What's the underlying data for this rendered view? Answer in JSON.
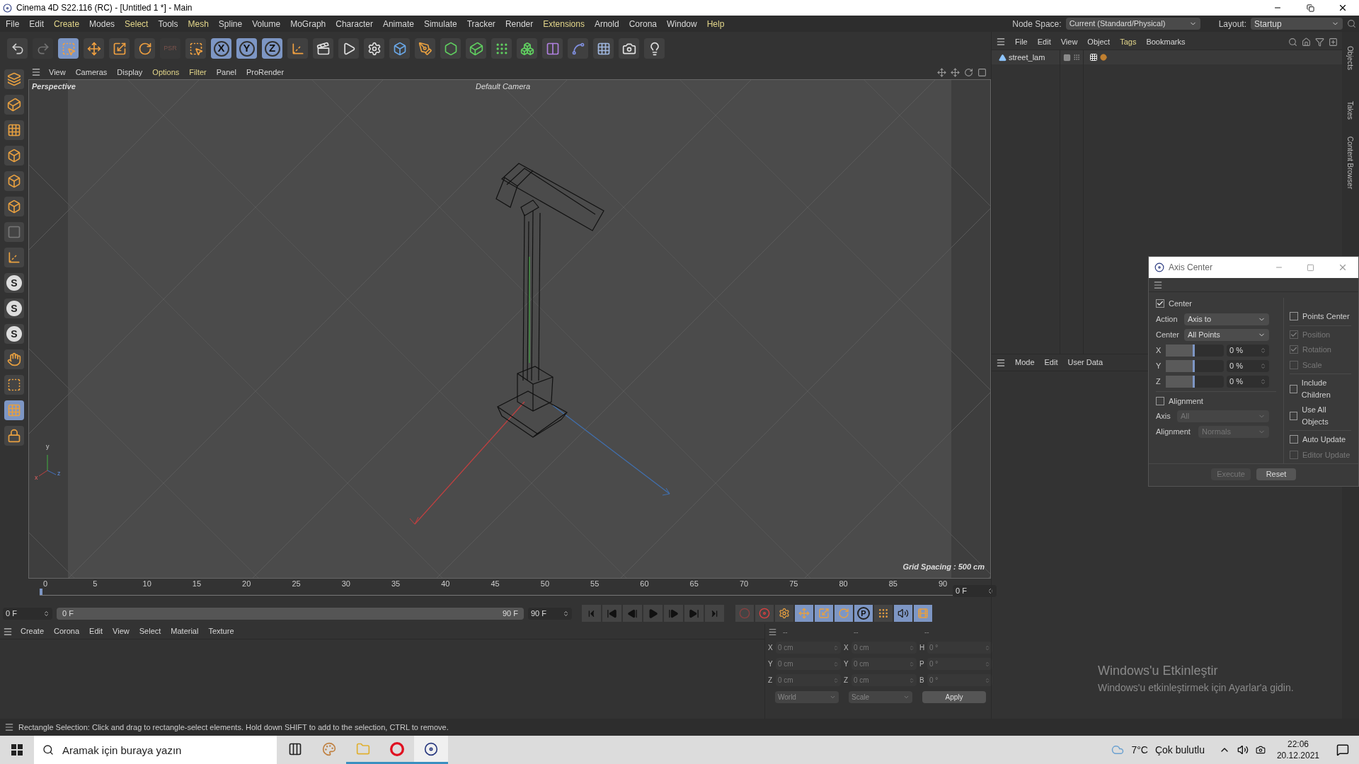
{
  "window": {
    "title": "Cinema 4D S22.116 (RC) - [Untitled 1 *] - Main"
  },
  "menu": [
    {
      "label": "File",
      "highlighted": false
    },
    {
      "label": "Edit",
      "highlighted": false
    },
    {
      "label": "Create",
      "highlighted": true
    },
    {
      "label": "Modes",
      "highlighted": false
    },
    {
      "label": "Select",
      "highlighted": true
    },
    {
      "label": "Tools",
      "highlighted": false
    },
    {
      "label": "Mesh",
      "highlighted": true
    },
    {
      "label": "Spline",
      "highlighted": false
    },
    {
      "label": "Volume",
      "highlighted": false
    },
    {
      "label": "MoGraph",
      "highlighted": false
    },
    {
      "label": "Character",
      "highlighted": false
    },
    {
      "label": "Animate",
      "highlighted": false
    },
    {
      "label": "Simulate",
      "highlighted": false
    },
    {
      "label": "Tracker",
      "highlighted": false
    },
    {
      "label": "Render",
      "highlighted": false
    },
    {
      "label": "Extensions",
      "highlighted": true
    },
    {
      "label": "Arnold",
      "highlighted": false
    },
    {
      "label": "Corona",
      "highlighted": false
    },
    {
      "label": "Window",
      "highlighted": false
    },
    {
      "label": "Help",
      "highlighted": true
    }
  ],
  "node_space": {
    "label": "Node Space:",
    "value": "Current (Standard/Physical)"
  },
  "layout": {
    "label": "Layout:",
    "value": "Startup"
  },
  "toolbar": [
    {
      "kind": "undo",
      "selected": false,
      "disabled": false
    },
    {
      "kind": "redo",
      "selected": false,
      "disabled": true
    },
    {
      "kind": "select",
      "selected": true,
      "disabled": false
    },
    {
      "kind": "move",
      "selected": false,
      "disabled": false
    },
    {
      "kind": "scale",
      "selected": false,
      "disabled": false
    },
    {
      "kind": "rotate",
      "selected": false,
      "disabled": false
    },
    {
      "kind": "text",
      "label": "PSR",
      "selected": false,
      "disabled": true
    },
    {
      "kind": "select",
      "selected": false,
      "disabled": false
    },
    {
      "kind": "axis",
      "label": "X",
      "selected": true,
      "disabled": false
    },
    {
      "kind": "axis",
      "label": "Y",
      "selected": true,
      "disabled": false
    },
    {
      "kind": "axis",
      "label": "Z",
      "selected": true,
      "disabled": false
    },
    {
      "kind": "coords",
      "selected": false,
      "disabled": false
    },
    {
      "kind": "render-view",
      "selected": false,
      "disabled": false
    },
    {
      "kind": "render",
      "selected": false,
      "disabled": false
    },
    {
      "kind": "render-settings",
      "selected": false,
      "disabled": false
    },
    {
      "kind": "cube",
      "selected": false,
      "disabled": false
    },
    {
      "kind": "pen",
      "selected": false,
      "disabled": false
    },
    {
      "kind": "subdivide",
      "selected": false,
      "disabled": false
    },
    {
      "kind": "extrude",
      "selected": false,
      "disabled": false
    },
    {
      "kind": "cloner",
      "selected": false,
      "disabled": false
    },
    {
      "kind": "boxes",
      "selected": false,
      "disabled": false
    },
    {
      "kind": "deformer",
      "selected": false,
      "disabled": false
    },
    {
      "kind": "bend",
      "selected": false,
      "disabled": false
    },
    {
      "kind": "floor",
      "selected": false,
      "disabled": false
    },
    {
      "kind": "camera",
      "selected": false,
      "disabled": false
    },
    {
      "kind": "light",
      "selected": false,
      "disabled": false
    }
  ],
  "left_toolbar": [
    {
      "kind": "editable",
      "selected": false
    },
    {
      "kind": "model",
      "selected": false
    },
    {
      "kind": "texture",
      "selected": false
    },
    {
      "kind": "points",
      "selected": false
    },
    {
      "kind": "edges",
      "selected": false
    },
    {
      "kind": "polygons",
      "selected": false
    },
    {
      "kind": "uv",
      "selected": false
    },
    {
      "kind": "axis-l",
      "selected": false
    },
    {
      "kind": "snap",
      "label": "S",
      "selected": false
    },
    {
      "kind": "snap",
      "label": "S",
      "selected": false
    },
    {
      "kind": "snap",
      "label": "S",
      "selected": false
    },
    {
      "kind": "tweak",
      "selected": false
    },
    {
      "kind": "workplane",
      "selected": false
    },
    {
      "kind": "grid",
      "selected": true
    },
    {
      "kind": "locked",
      "selected": false
    }
  ],
  "viewport": {
    "menu": [
      {
        "label": "View",
        "highlighted": false
      },
      {
        "label": "Cameras",
        "highlighted": false
      },
      {
        "label": "Display",
        "highlighted": false
      },
      {
        "label": "Options",
        "highlighted": true
      },
      {
        "label": "Filter",
        "highlighted": true
      },
      {
        "label": "Panel",
        "highlighted": false
      },
      {
        "label": "ProRender",
        "highlighted": false
      }
    ],
    "label": "Perspective",
    "camera": "Default Camera",
    "gizmo_labels": [
      "y",
      "x",
      "z"
    ],
    "grid_spacing": "Grid Spacing : 500 cm"
  },
  "object_manager": {
    "menu": [
      {
        "label": "File",
        "highlighted": false
      },
      {
        "label": "Edit",
        "highlighted": false
      },
      {
        "label": "View",
        "highlighted": false
      },
      {
        "label": "Object",
        "highlighted": false
      },
      {
        "label": "Tags",
        "highlighted": true
      },
      {
        "label": "Bookmarks",
        "highlighted": false
      }
    ],
    "objects": [
      {
        "name": "street_lam"
      }
    ]
  },
  "side_tabs": [
    "Objects",
    "Takes",
    "Content Browser"
  ],
  "attributes": {
    "menu": [
      "Mode",
      "Edit",
      "User Data"
    ]
  },
  "axis_center": {
    "title": "Axis Center",
    "center": {
      "label": "Center",
      "checked": true
    },
    "action": {
      "label": "Action",
      "value": "Axis to"
    },
    "center_select": {
      "label": "Center",
      "value": "All Points"
    },
    "sliders": [
      {
        "label": "X",
        "level": 0.5,
        "reading": "0 %"
      },
      {
        "label": "Y",
        "level": 0.5,
        "reading": "0 %"
      },
      {
        "label": "Z",
        "level": 0.5,
        "reading": "0 %"
      }
    ],
    "alignment": {
      "label": "Alignment",
      "checked": false
    },
    "axis": {
      "label": "Axis",
      "value": "All",
      "disabled": true
    },
    "alignment_select": {
      "label": "Alignment",
      "value": "Normals",
      "disabled": true
    },
    "groups": [
      {
        "options": [
          {
            "label": "Points Center",
            "checked": false,
            "disabled": false
          }
        ]
      },
      {
        "options": [
          {
            "label": "Position",
            "checked": true,
            "disabled": true
          },
          {
            "label": "Rotation",
            "checked": true,
            "disabled": true
          },
          {
            "label": "Scale",
            "checked": false,
            "disabled": true
          }
        ]
      },
      {
        "options": [
          {
            "label": "Include Children",
            "checked": false,
            "disabled": false
          },
          {
            "label": "Use All Objects",
            "checked": false,
            "disabled": false
          }
        ]
      },
      {
        "options": [
          {
            "label": "Auto Update",
            "checked": false,
            "disabled": false
          },
          {
            "label": "Editor Update",
            "checked": false,
            "disabled": true
          }
        ]
      }
    ],
    "buttons": [
      {
        "label": "Execute",
        "disabled": true
      },
      {
        "label": "Reset",
        "disabled": false
      }
    ]
  },
  "timeline": {
    "ticks": [
      "0",
      "5",
      "10",
      "15",
      "20",
      "25",
      "30",
      "35",
      "40",
      "45",
      "50",
      "55",
      "60",
      "65",
      "70",
      "75",
      "80",
      "85",
      "90"
    ],
    "current": "0 F",
    "start": "0 F",
    "range_start": "0 F",
    "range_end": "90 F",
    "end": "90 F"
  },
  "transport": [
    {
      "kind": "first"
    },
    {
      "kind": "prev-key"
    },
    {
      "kind": "prev"
    },
    {
      "kind": "play"
    },
    {
      "kind": "next"
    },
    {
      "kind": "next-key"
    },
    {
      "kind": "last"
    }
  ],
  "key_tools": [
    {
      "kind": "record",
      "selected": false
    },
    {
      "kind": "auto-key",
      "selected": false
    },
    {
      "kind": "key-settings",
      "selected": false
    },
    {
      "kind": "move",
      "selected": true
    },
    {
      "kind": "scale",
      "selected": true
    },
    {
      "kind": "rotate",
      "selected": true
    },
    {
      "kind": "param",
      "label": "P",
      "selected": true
    },
    {
      "kind": "points",
      "selected": false
    },
    {
      "kind": "sound",
      "selected": true
    },
    {
      "kind": "film",
      "selected": true
    }
  ],
  "material_manager": {
    "menu": [
      "Create",
      "Corona",
      "Edit",
      "View",
      "Select",
      "Material",
      "Texture"
    ]
  },
  "coordinates": {
    "headers": [
      "--",
      "--",
      "--"
    ],
    "rows": [
      [
        {
          "label": "X",
          "value": "0 cm"
        },
        {
          "label": "X",
          "value": "0 cm"
        },
        {
          "label": "H",
          "value": "0 °"
        }
      ],
      [
        {
          "label": "Y",
          "value": "0 cm"
        },
        {
          "label": "Y",
          "value": "0 cm"
        },
        {
          "label": "P",
          "value": "0 °"
        }
      ],
      [
        {
          "label": "Z",
          "value": "0 cm"
        },
        {
          "label": "Z",
          "value": "0 cm"
        },
        {
          "label": "B",
          "value": "0 °"
        }
      ]
    ],
    "selects": [
      "World",
      "Scale"
    ],
    "apply": "Apply",
    "disabled": true
  },
  "activation": {
    "title": "Windows'u Etkinleştir",
    "text": "Windows'u etkinleştirmek için Ayarlar'a gidin."
  },
  "status_bar": "Rectangle Selection: Click and drag to rectangle-select elements. Hold down SHIFT to add to the selection, CTRL to remove.",
  "taskbar": {
    "search": {
      "placeholder": "Aramak için buraya yazın"
    },
    "apps": [
      {
        "kind": "task-view",
        "running": false,
        "selected": false
      },
      {
        "kind": "paint",
        "running": false,
        "selected": false
      },
      {
        "kind": "folder",
        "running": true,
        "selected": false
      },
      {
        "kind": "opera",
        "running": true,
        "selected": false
      },
      {
        "kind": "cinema",
        "running": true,
        "selected": true
      }
    ],
    "temperature": "7°C",
    "weather": "Çok bulutlu",
    "time": "22:06",
    "date": "20.12.2021"
  }
}
